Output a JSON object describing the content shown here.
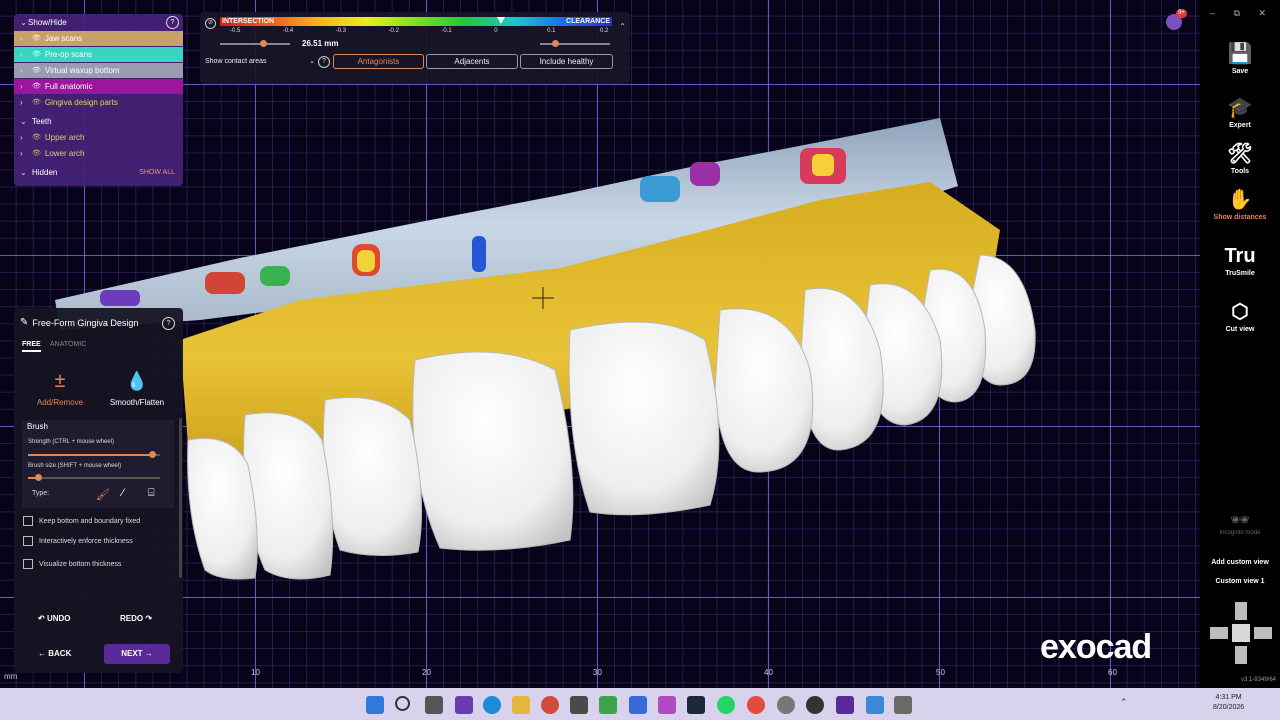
{
  "show_hide": {
    "title": "Show/Hide",
    "groups": [
      {
        "label": "Jaw scans",
        "color": "#c7a06a"
      },
      {
        "label": "Pre-op scans",
        "color": "#38d6c2"
      },
      {
        "label": "Virtual waxup bottom",
        "color": "#9a9ab0"
      },
      {
        "label": "Full anatomic",
        "color": "#9b159e"
      },
      {
        "label": "Gingiva design parts",
        "color": "transparent"
      }
    ],
    "teeth_header": "Teeth",
    "teeth": [
      {
        "label": "Upper arch",
        "color": "transparent"
      },
      {
        "label": "Lower arch",
        "color": "transparent"
      }
    ],
    "hidden_label": "Hidden",
    "show_all": "SHOW ALL"
  },
  "distance": {
    "intersection": "INTERSECTION",
    "clearance": "CLEARANCE",
    "ticks": [
      "-0.5",
      "-0.4",
      "-0.3",
      "-0.2",
      "-0.1",
      "0",
      "0.1",
      "0.2"
    ],
    "value": "26.51 mm",
    "show_contact": "Show contact areas",
    "buttons": [
      "Antagonists",
      "Adjacents",
      "Include healthy"
    ]
  },
  "gingiva_panel": {
    "title": "Free-Form Gingiva Design",
    "tabs": [
      "FREE",
      "ANATOMIC"
    ],
    "tools": [
      "Add/Remove",
      "Smooth/Flatten"
    ],
    "brush_header": "Brush",
    "strength_label": "Strength (CTRL + mouse wheel)",
    "strength_value": 0.95,
    "size_label": "Brush size (SHIFT + mouse wheel)",
    "size_value": 0.08,
    "type_label": "Type:",
    "options": [
      "Keep bottom and boundary fixed",
      "Interactively enforce thickness",
      "Visualize bottom thickness"
    ],
    "undo": "UNDO",
    "redo": "REDO",
    "back": "BACK",
    "next": "NEXT"
  },
  "axis": {
    "unit": "mm",
    "bottom_ticks": [
      "10",
      "20",
      "30",
      "40",
      "50",
      "60"
    ]
  },
  "sidebar": {
    "items": [
      {
        "label": "Save",
        "icon": "save-icon",
        "glyph": "💾"
      },
      {
        "label": "Expert",
        "icon": "graduation-cap-icon",
        "glyph": "🎓"
      },
      {
        "label": "Tools",
        "icon": "tools-icon",
        "glyph": "🛠"
      },
      {
        "label": "Show distances",
        "icon": "distance-icon",
        "glyph": "✋"
      },
      {
        "label": "TruSmile",
        "icon": "trusmile-icon",
        "glyph": "Tru"
      },
      {
        "label": "Cut view",
        "icon": "cut-view-icon",
        "glyph": "⬡"
      }
    ],
    "incognito": "Incognito mode",
    "add_custom_view": "Add custom view",
    "custom_view": "Custom view 1",
    "version": "v3.1-8349/64",
    "notification_count": "9+"
  },
  "brand": "exocad",
  "colors": {
    "accent": "#e0875a",
    "gingiva": "#e5bd2a",
    "teeth": "#f2f2f2",
    "panel": "#171526",
    "purple": "#5a2a9a"
  },
  "taskbar": {
    "time": "4:31 PM",
    "date": "8/20/2026"
  }
}
